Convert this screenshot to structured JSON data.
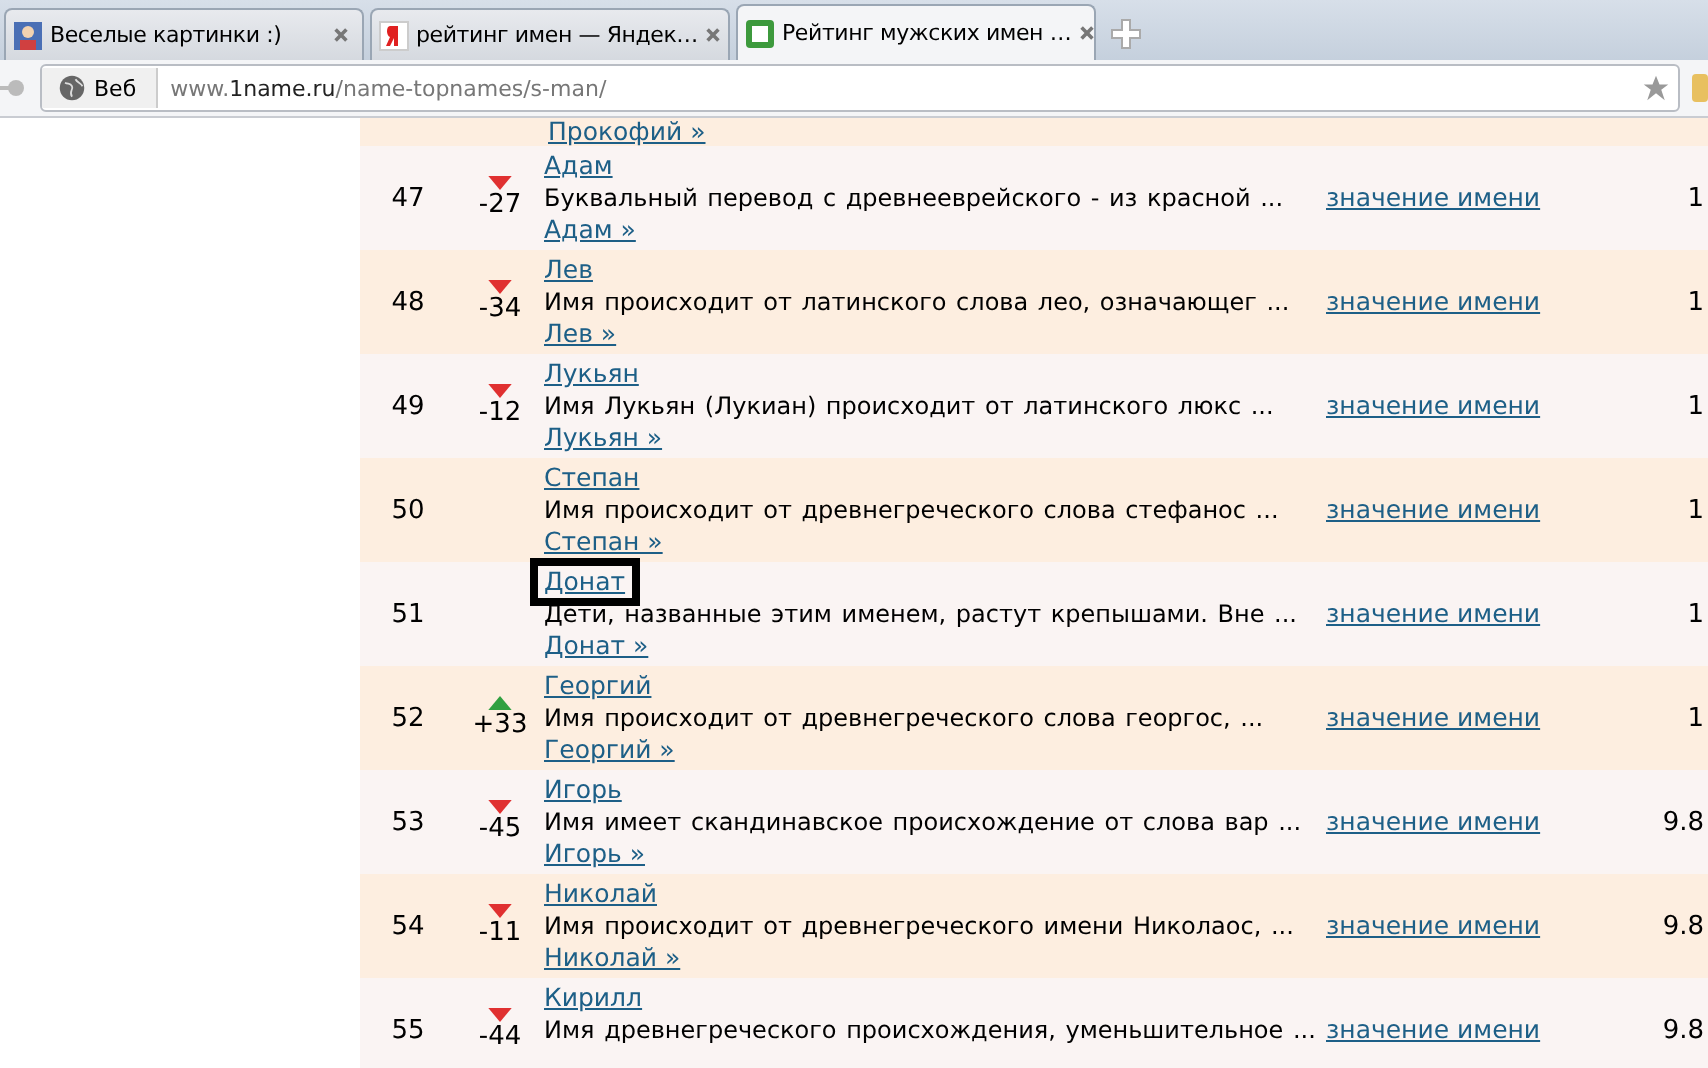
{
  "tabs": [
    {
      "title": "Веселые картинки :)",
      "selected": false
    },
    {
      "title": "рейтинг имен — Яндек…",
      "selected": false
    },
    {
      "title": "Рейтинг мужских имен …",
      "selected": true
    }
  ],
  "address_bar": {
    "site_button": "Веб",
    "url_prefix": "www.",
    "url_domain": "1name.ru",
    "url_path": "/name-topnames/s-man/"
  },
  "table": {
    "top_link": "Прокофий »",
    "rows": [
      {
        "rank": "47",
        "kind": "down",
        "change": "-27",
        "name": "Адам",
        "description": "Буквальный перевод с древнееврейского - из красной ...",
        "meaning_link": "значение имени",
        "name_link": "Адам »",
        "column_5": "1",
        "highlighted": false
      },
      {
        "rank": "48",
        "kind": "down",
        "change": "-34",
        "name": "Лев",
        "description": "Имя происходит от латинского слова лео, означающег ...",
        "meaning_link": "значение имени",
        "name_link": "Лев »",
        "column_5": "1",
        "highlighted": false
      },
      {
        "rank": "49",
        "kind": "down",
        "change": "-12",
        "name": "Лукьян",
        "description": "Имя Лукьян (Лукиан) происходит от латинского люкс ...",
        "meaning_link": "значение имени",
        "name_link": "Лукьян »",
        "column_5": "1",
        "highlighted": false
      },
      {
        "rank": "50",
        "kind": "none",
        "name": "Степан",
        "description": "Имя происходит от древнегреческого слова стефанос ...",
        "meaning_link": "значение имени",
        "name_link": "Степан »",
        "column_5": "1",
        "highlighted": false
      },
      {
        "rank": "51",
        "kind": "none",
        "name": "Донат",
        "description": "Дети, названные этим именем, растут крепышами. Вне ...",
        "meaning_link": "значение имени",
        "name_link": "Донат »",
        "column_5": "1",
        "highlighted": true
      },
      {
        "rank": "52",
        "kind": "up",
        "change": "+33",
        "name": "Георгий",
        "description": "Имя происходит от древнегреческого слова георгос, ...",
        "meaning_link": "значение имени",
        "name_link": "Георгий »",
        "column_5": "1",
        "highlighted": false
      },
      {
        "rank": "53",
        "kind": "down",
        "change": "-45",
        "name": "Игорь",
        "description": "Имя имеет скандинавское происхождение от слова вар ...",
        "meaning_link": "значение имени",
        "name_link": "Игорь »",
        "column_5": "9.8",
        "highlighted": false
      },
      {
        "rank": "54",
        "kind": "down",
        "change": "-11",
        "name": "Николай",
        "description": "Имя происходит от древнегреческого имени Николаос, ...",
        "meaning_link": "значение имени",
        "name_link": "Николай »",
        "column_5": "9.8",
        "highlighted": false
      },
      {
        "rank": "55",
        "kind": "down",
        "change": "-44",
        "name": "Кирилл",
        "description": "Имя древнегреческого происхождения, уменьшительное ...",
        "meaning_link": "значение имени",
        "column_5": "9.8",
        "highlighted": false
      }
    ]
  }
}
